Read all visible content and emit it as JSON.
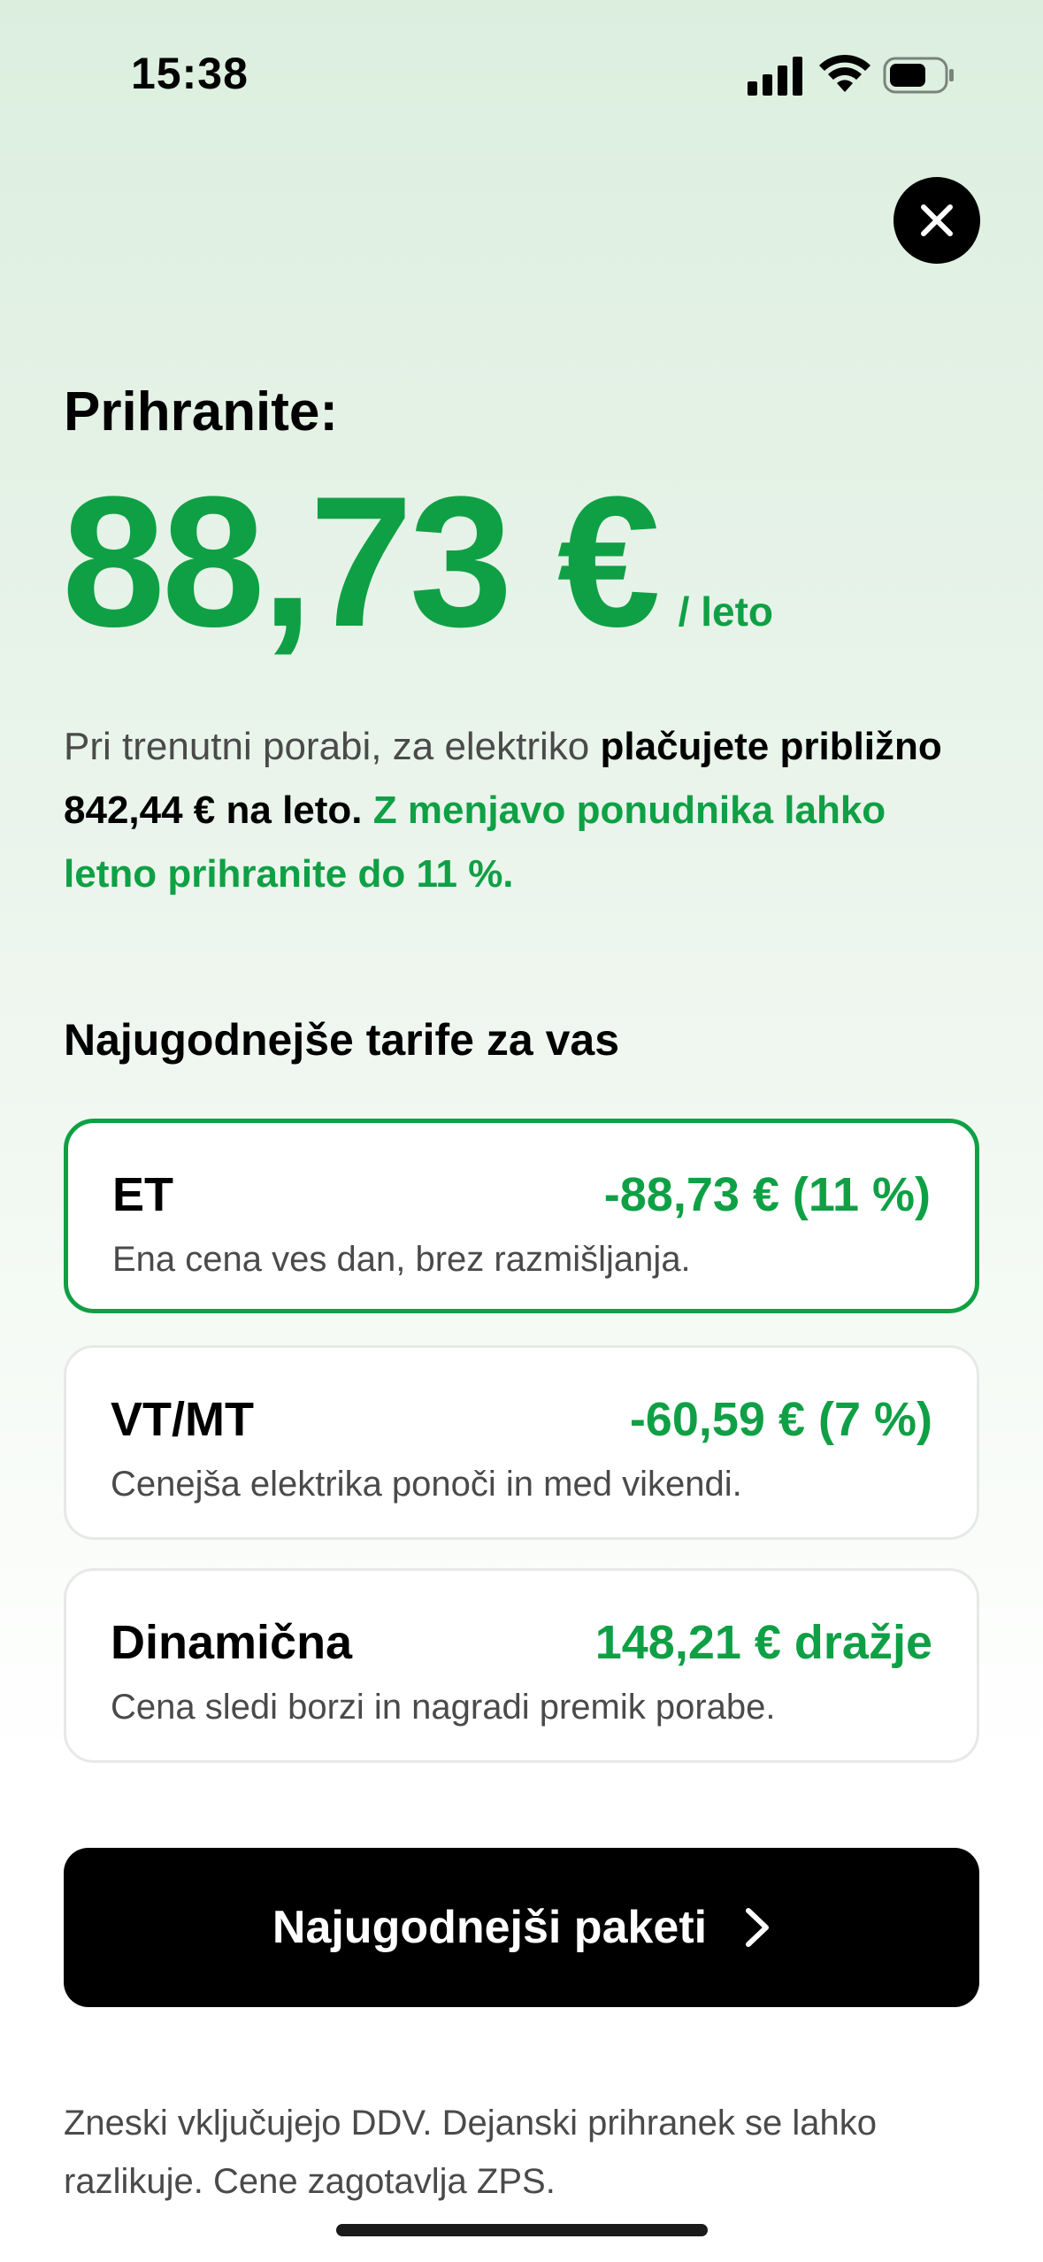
{
  "status_bar": {
    "time": "15:38"
  },
  "hero": {
    "heading": "Prihranite:",
    "amount": "88,73 €",
    "unit": "/ leto"
  },
  "description": {
    "part1": "Pri trenutni porabi, za elektriko ",
    "part2": "plačujete približno 842,44 € na leto.",
    "part3": " ",
    "part4": "Z menjavo ponudnika lahko letno prihranite do 11 %."
  },
  "section_title": "Najugodnejše tarife za vas",
  "tariffs": [
    {
      "name": "ET",
      "saving": "-88,73 € (11 %)",
      "description": "Ena cena ves dan, brez razmišljanja.",
      "selected": true
    },
    {
      "name": "VT/MT",
      "saving": "-60,59 € (7 %)",
      "description": "Cenejša elektrika ponoči in med vikendi.",
      "selected": false
    },
    {
      "name": "Dinamična",
      "saving": "148,21 € dražje",
      "description": "Cena sledi borzi in nagradi premik porabe.",
      "selected": false
    }
  ],
  "cta": {
    "label": "Najugodnejši paketi"
  },
  "footnote": "Zneski vključujejo DDV. Dejanski prihranek se lahko razlikuje. Cene zagotavlja ZPS.",
  "colors": {
    "accent": "#0fa045",
    "button": "#000000"
  },
  "icons": [
    "signal-icon",
    "wifi-icon",
    "battery-icon",
    "close-icon",
    "chevron-right-icon"
  ]
}
